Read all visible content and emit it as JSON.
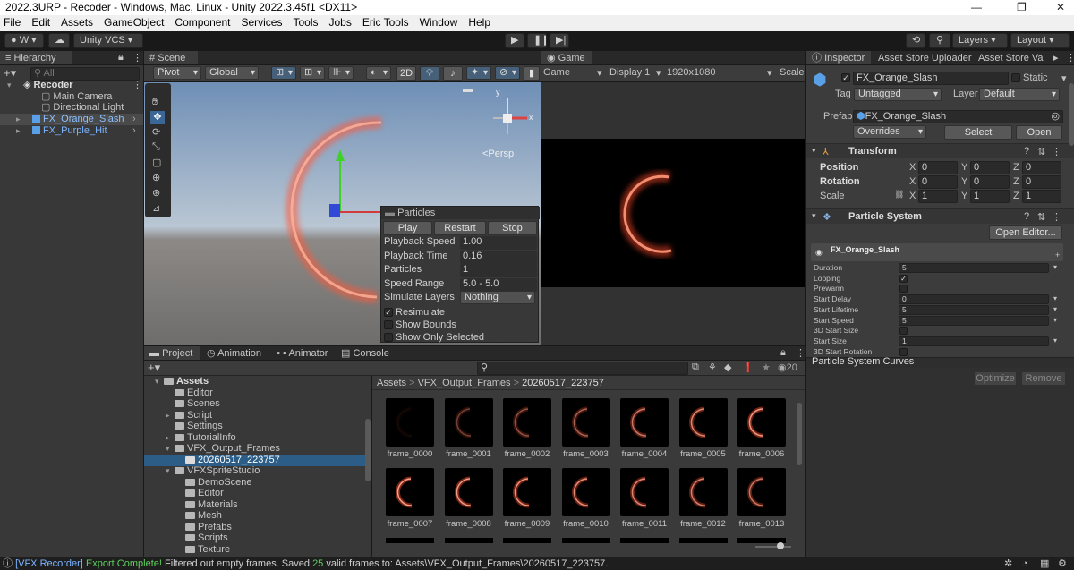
{
  "window": {
    "title": "2022.3URP - Recoder - Windows, Mac, Linux - Unity 2022.3.45f1 <DX11>",
    "minimize": "—",
    "maximize": "❐",
    "close": "✕"
  },
  "menu": [
    "File",
    "Edit",
    "Assets",
    "GameObject",
    "Component",
    "Services",
    "Tools",
    "Jobs",
    "Eric Tools",
    "Window",
    "Help"
  ],
  "toolbar": {
    "account": "W",
    "vcs": "Unity VCS",
    "layers": "Layers",
    "layout": "Layout"
  },
  "hierarchy": {
    "tab": "Hierarchy",
    "search_placeholder": "All",
    "items": [
      {
        "label": "Recoder",
        "indent": 0
      },
      {
        "label": "Main Camera",
        "indent": 2
      },
      {
        "label": "Directional Light",
        "indent": 2
      },
      {
        "label": "FX_Orange_Slash",
        "indent": 1
      },
      {
        "label": "FX_Purple_Hit",
        "indent": 1
      }
    ]
  },
  "scene": {
    "tab": "Scene",
    "pivot": "Pivot",
    "global": "Global",
    "mode_2d": "2D",
    "persp": "<Persp",
    "axis_y": "y",
    "axis_x": "x",
    "particles": {
      "title": "Particles",
      "play": "Play",
      "restart": "Restart",
      "stop": "Stop",
      "rows": [
        {
          "label": "Playback Speed",
          "value": "1.00"
        },
        {
          "label": "Playback Time",
          "value": "0.16"
        },
        {
          "label": "Particles",
          "value": "1"
        },
        {
          "label": "Speed Range",
          "value": "5.0 - 5.0"
        }
      ],
      "simulate_label": "Simulate Layers",
      "simulate_value": "Nothing",
      "checks": [
        {
          "label": "Resimulate",
          "checked": true
        },
        {
          "label": "Show Bounds",
          "checked": false
        },
        {
          "label": "Show Only Selected",
          "checked": false
        }
      ]
    }
  },
  "game": {
    "tab": "Game",
    "mode": "Game",
    "display": "Display 1",
    "resolution": "1920x1080",
    "scale": "Scale"
  },
  "inspector": {
    "tabs": [
      "Inspector",
      "Asset Store Uploader",
      "Asset Store Va"
    ],
    "object_name": "FX_Orange_Slash",
    "static": "Static",
    "tag_label": "Tag",
    "tag": "Untagged",
    "layer_label": "Layer",
    "layer": "Default",
    "prefab_label": "Prefab",
    "prefab": "FX_Orange_Slash",
    "overrides": "Overrides",
    "select": "Select",
    "open": "Open",
    "transform": {
      "title": "Transform",
      "rows": [
        {
          "label": "Position",
          "x": "0",
          "y": "0",
          "z": "0"
        },
        {
          "label": "Rotation",
          "x": "0",
          "y": "0",
          "z": "0"
        },
        {
          "label": "Scale",
          "x": "1",
          "y": "1",
          "z": "1"
        }
      ]
    },
    "particle_system": {
      "title": "Particle System",
      "open_editor": "Open Editor...",
      "module": "FX_Orange_Slash",
      "rows": [
        {
          "label": "Duration",
          "value": "5",
          "kind": "field"
        },
        {
          "label": "Looping",
          "value": "✓",
          "kind": "check"
        },
        {
          "label": "Prewarm",
          "value": "",
          "kind": "check"
        },
        {
          "label": "Start Delay",
          "value": "0",
          "kind": "field"
        },
        {
          "label": "Start Lifetime",
          "value": "5",
          "kind": "field"
        },
        {
          "label": "Start Speed",
          "value": "5",
          "kind": "field"
        },
        {
          "label": "3D Start Size",
          "value": "",
          "kind": "check"
        },
        {
          "label": "Start Size",
          "value": "1",
          "kind": "field"
        },
        {
          "label": "3D Start Rotation",
          "value": "",
          "kind": "check"
        }
      ]
    },
    "curves": {
      "title": "Particle System Curves",
      "optimize": "Optimize",
      "remove": "Remove"
    }
  },
  "project": {
    "tabs": [
      "Project",
      "Animation",
      "Animator",
      "Console"
    ],
    "count": "20",
    "breadcrumb": [
      "Assets",
      "VFX_Output_Frames",
      "20260517_223757"
    ],
    "tree": [
      {
        "label": "Assets",
        "indent": 0,
        "bold": true
      },
      {
        "label": "Editor",
        "indent": 1
      },
      {
        "label": "Scenes",
        "indent": 1
      },
      {
        "label": "Script",
        "indent": 1
      },
      {
        "label": "Settings",
        "indent": 1
      },
      {
        "label": "TutorialInfo",
        "indent": 1
      },
      {
        "label": "VFX_Output_Frames",
        "indent": 1
      },
      {
        "label": "20260517_223757",
        "indent": 2,
        "selected": true
      },
      {
        "label": "VFXSpriteStudio",
        "indent": 1
      },
      {
        "label": "DemoScene",
        "indent": 2
      },
      {
        "label": "Editor",
        "indent": 2
      },
      {
        "label": "Materials",
        "indent": 2
      },
      {
        "label": "Mesh",
        "indent": 2
      },
      {
        "label": "Prefabs",
        "indent": 2
      },
      {
        "label": "Scripts",
        "indent": 2
      },
      {
        "label": "Texture",
        "indent": 2
      }
    ],
    "frames": [
      "frame_0000",
      "frame_0001",
      "frame_0002",
      "frame_0003",
      "frame_0004",
      "frame_0005",
      "frame_0006",
      "frame_0007",
      "frame_0008",
      "frame_0009",
      "frame_0010",
      "frame_0011",
      "frame_0012",
      "frame_0013"
    ],
    "frame_intensity": [
      0.05,
      0.35,
      0.45,
      0.55,
      0.7,
      0.8,
      0.95,
      1.0,
      0.95,
      0.9,
      0.85,
      0.8,
      0.75,
      0.7
    ]
  },
  "status": {
    "prefix": "[VFX Recorder]",
    "highlight": "Export Complete!",
    "text_a": " Filtered out empty frames. Saved ",
    "count": "25",
    "text_b": " valid frames to: Assets\\VFX_Output_Frames\\20260517_223757."
  },
  "colors": {
    "accent": "#2c5d87",
    "ring": "#ff4a2a",
    "status_highlight": "#5ed05e",
    "link": "#7cb4ff"
  }
}
